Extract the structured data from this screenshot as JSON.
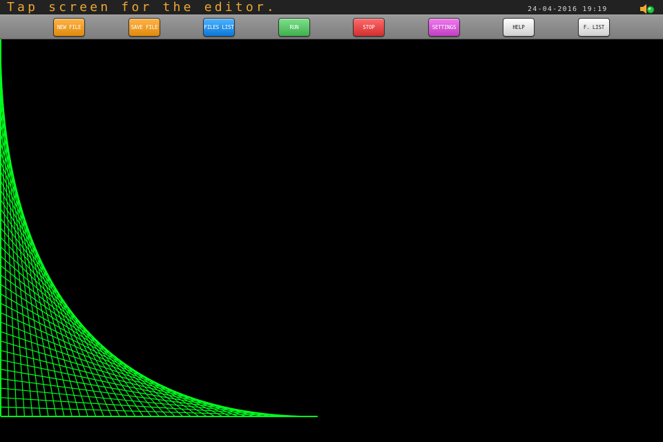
{
  "statusbar": {
    "message": "Tap screen for the editor.",
    "datetime": "24-04-2016 19:19",
    "sound_icon": "speaker-icon"
  },
  "toolbar": {
    "buttons": [
      {
        "label": "NEW FILE",
        "color": "#e9960f"
      },
      {
        "label": "SAVE FILE",
        "color": "#e9960f"
      },
      {
        "label": "FILES LIST",
        "color": "#1e88e5"
      },
      {
        "label": "RUN",
        "color": "#4caf50"
      },
      {
        "label": "STOP",
        "color": "#e53935"
      },
      {
        "label": "SETTINGS",
        "color": "#d04ed0"
      },
      {
        "label": "HELP",
        "color": "#e0e0e0"
      },
      {
        "label": "F. LIST",
        "color": "#e0e0e0"
      }
    ]
  },
  "canvas": {
    "line_color": "#00ff1e",
    "pattern": "string-art curve envelope",
    "line_count": 40
  }
}
